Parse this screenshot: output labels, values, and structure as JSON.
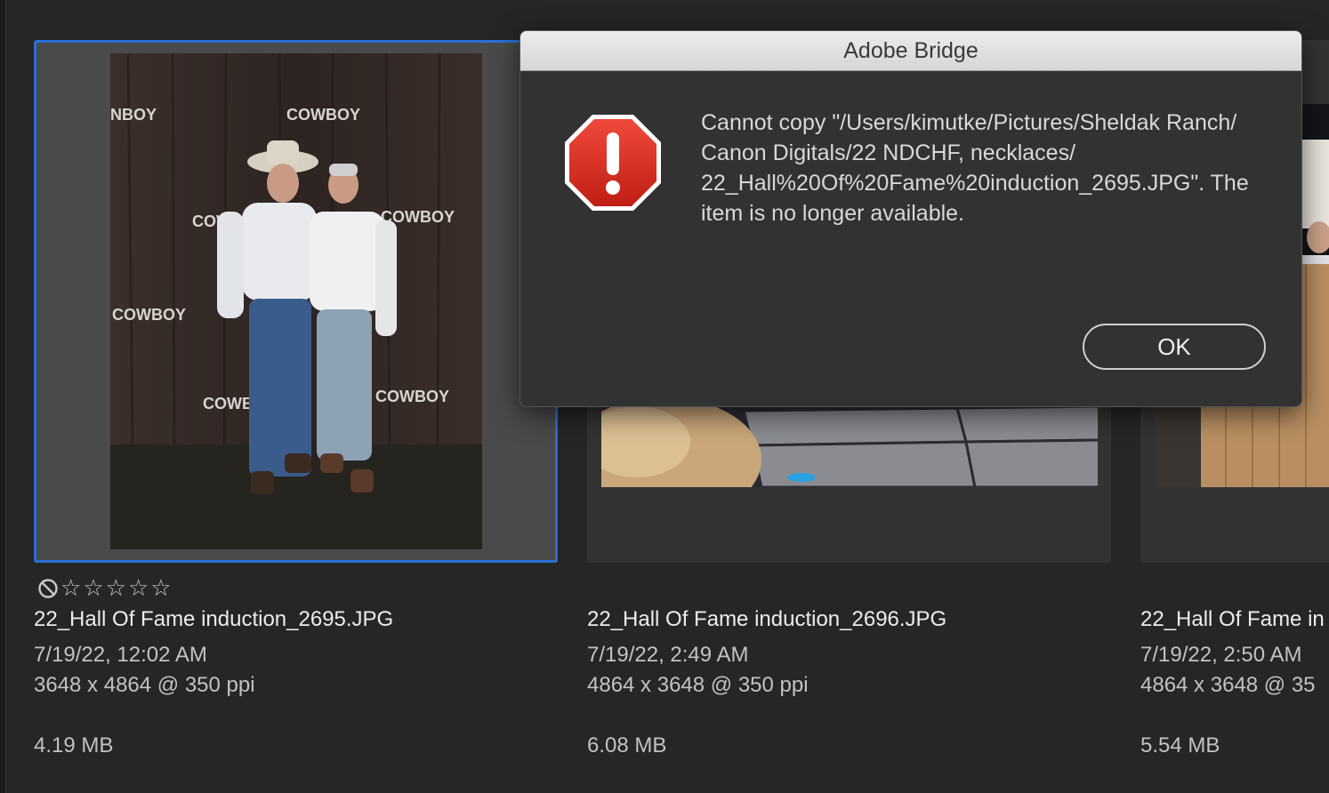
{
  "dialog": {
    "title": "Adobe Bridge",
    "message": "Cannot copy \"/Users/kimutke/Pictures/Sheldak Ranch/ Canon Digitals/22 NDCHF, necklaces/ 22_Hall%20Of%20Fame%20induction_2695.JPG\". The item is no longer available.",
    "ok_label": "OK",
    "icon": "stop-alert-icon"
  },
  "thumbnails": [
    {
      "filename": "22_Hall Of Fame induction_2695.JPG",
      "date": "7/19/22, 12:02 AM",
      "dimensions": "3648 x 4864 @ 350 ppi",
      "size": "4.19 MB",
      "rating": "0 stars",
      "selected": true
    },
    {
      "filename": "22_Hall Of Fame induction_2696.JPG",
      "date": "7/19/22, 2:49 AM",
      "dimensions": "4864 x 3648 @ 350 ppi",
      "size": "6.08 MB",
      "selected": false
    },
    {
      "filename": "22_Hall Of Fame in",
      "date": "7/19/22, 2:50 AM",
      "dimensions": "4864 x 3648 @ 35",
      "size": "5.54 MB",
      "selected": false
    }
  ],
  "colors": {
    "selection": "#2a6fd6",
    "alert_red": "#d42a1e"
  }
}
